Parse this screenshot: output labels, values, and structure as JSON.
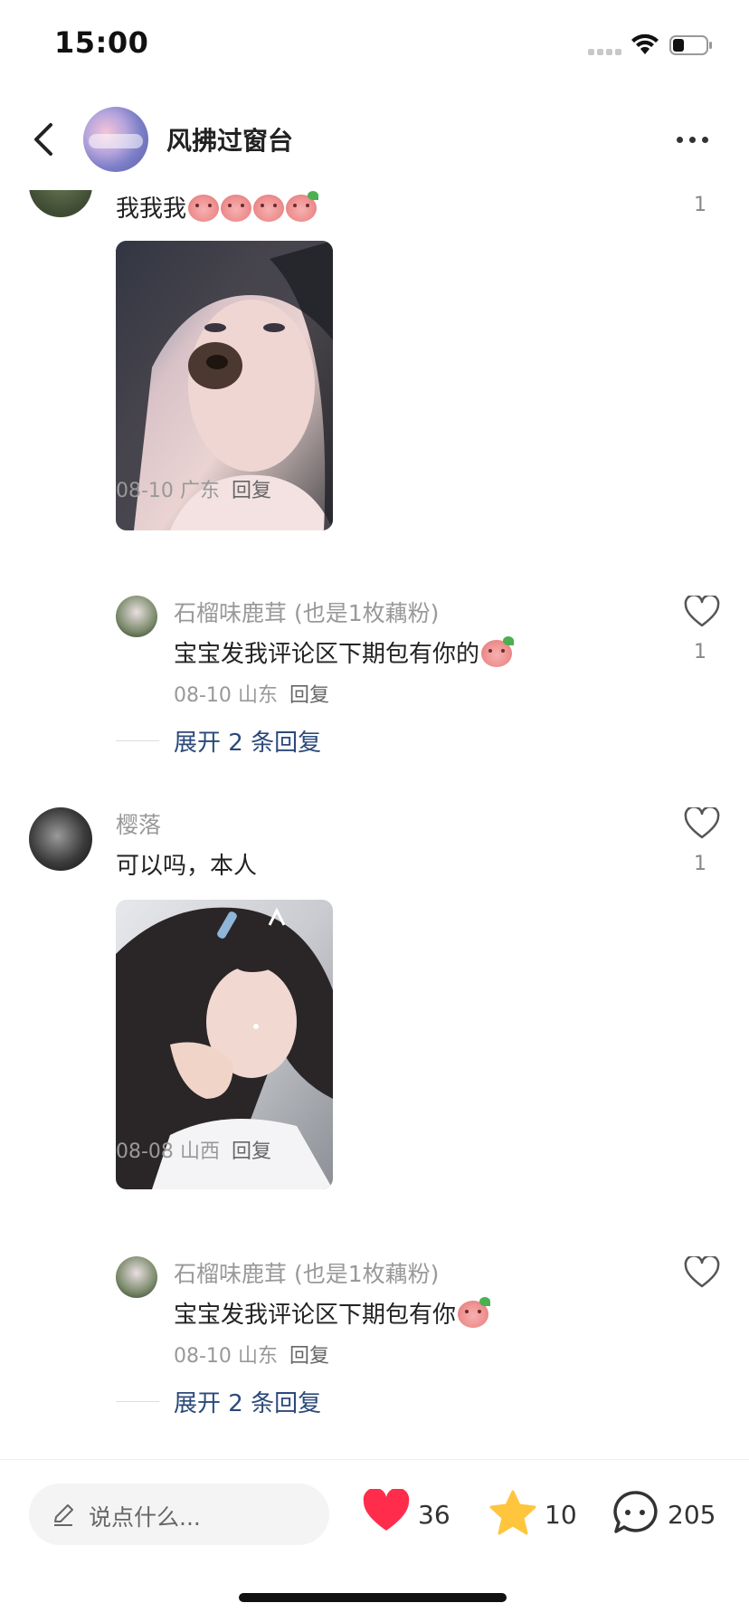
{
  "status_bar": {
    "time": "15:00"
  },
  "header": {
    "title": "风拂过窗台"
  },
  "comments": [
    {
      "text": "我我我",
      "like_count": "1",
      "meta": {
        "date": "08-10",
        "location": "广东",
        "reply_label": "回复"
      },
      "replies": [
        {
          "name": "石榴味鹿茸 (也是1枚藕粉)",
          "text": "宝宝发我评论区下期包有你的",
          "like_count": "1",
          "meta": {
            "date": "08-10",
            "location": "山东",
            "reply_label": "回复"
          }
        }
      ],
      "expand_label": "展开 2 条回复"
    },
    {
      "name": "樱落",
      "text": "可以吗，本人",
      "like_count": "1",
      "meta": {
        "date": "08-08",
        "location": "山西",
        "reply_label": "回复"
      },
      "replies": [
        {
          "name": "石榴味鹿茸 (也是1枚藕粉)",
          "text": "宝宝发我评论区下期包有你",
          "like_count": "",
          "meta": {
            "date": "08-10",
            "location": "山东",
            "reply_label": "回复"
          }
        }
      ],
      "expand_label": "展开 2 条回复"
    }
  ],
  "bottom_bar": {
    "input_placeholder": "说点什么...",
    "likes": "36",
    "favorites": "10",
    "comments": "205"
  },
  "colors": {
    "accent_link": "#2b4a7a",
    "like_red": "#ff2c4c",
    "star_yellow": "#ffc53d"
  },
  "icons": [
    "back-arrow-icon",
    "more-icon",
    "heart-outline-icon",
    "pen-icon",
    "heart-filled-icon",
    "star-filled-icon",
    "comment-bubble-icon",
    "wifi-icon",
    "battery-icon",
    "signal-icon"
  ]
}
